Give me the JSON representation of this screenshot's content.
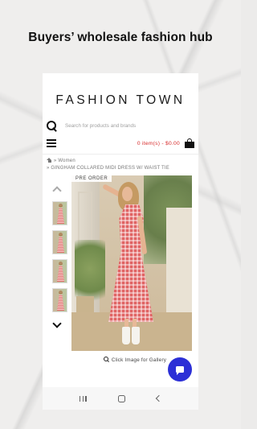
{
  "promo": {
    "headline": "Buyers’ wholesale fashion hub"
  },
  "app": {
    "brand": "FASHION TOWN",
    "search": {
      "placeholder": "Search for products and brands",
      "icon": "search-icon"
    },
    "cart": {
      "text": "0 item(s) - $0.00",
      "icon": "bag-icon"
    },
    "menu_icon": "hamburger-menu-icon",
    "breadcrumb": {
      "home_icon": "home-icon",
      "sep": "»",
      "category": "Women",
      "product": "GINGHAM COLLARED MIDI DRESS W/ WAIST TIE"
    },
    "product": {
      "badge": "PRE ORDER",
      "zoom_hint": "Click Image for Gallery"
    },
    "thumbnails_count": 4
  },
  "colors": {
    "cart_text": "#d62828",
    "chat_button": "#2c2fd6"
  }
}
